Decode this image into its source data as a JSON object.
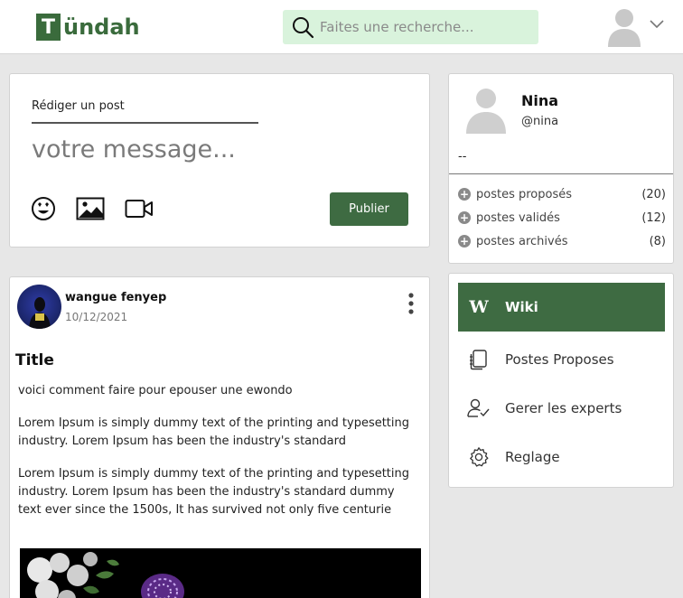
{
  "header": {
    "logo_letter": "T",
    "logo_text": "ündah",
    "search_placeholder": "Faites une recherche..."
  },
  "compose": {
    "label": "Rédiger un post",
    "placeholder": "votre message...",
    "publish_label": "Publier"
  },
  "profile": {
    "name": "Nina",
    "handle": "@nina",
    "bio": "--",
    "stats": [
      {
        "label": "postes proposés",
        "count": "(20)"
      },
      {
        "label": "postes validés",
        "count": "(12)"
      },
      {
        "label": "postes archivés",
        "count": "(8)"
      }
    ]
  },
  "menu": {
    "items": [
      {
        "label": "Wiki",
        "icon": "wiki-icon"
      },
      {
        "label": "Postes Proposes",
        "icon": "documents-icon"
      },
      {
        "label": "Gerer les experts",
        "icon": "user-check-icon"
      },
      {
        "label": "Reglage",
        "icon": "gear-icon"
      }
    ]
  },
  "post": {
    "author": "wangue fenyep",
    "date": "10/12/2021",
    "title": "Title",
    "paragraphs": [
      "voici comment faire pour epouser une ewondo",
      "Lorem Ipsum is simply dummy text of the printing and typesetting industry. Lorem Ipsum has been the industry's standard",
      "Lorem Ipsum is simply dummy text of the printing and typesetting industry. Lorem Ipsum has been the industry's standard dummy text ever since the 1500s, It has survived not only five centurie"
    ]
  },
  "colors": {
    "brand_green": "#3a6b3c",
    "search_bg": "#d9f3dc",
    "button_green": "#3e6b42"
  }
}
